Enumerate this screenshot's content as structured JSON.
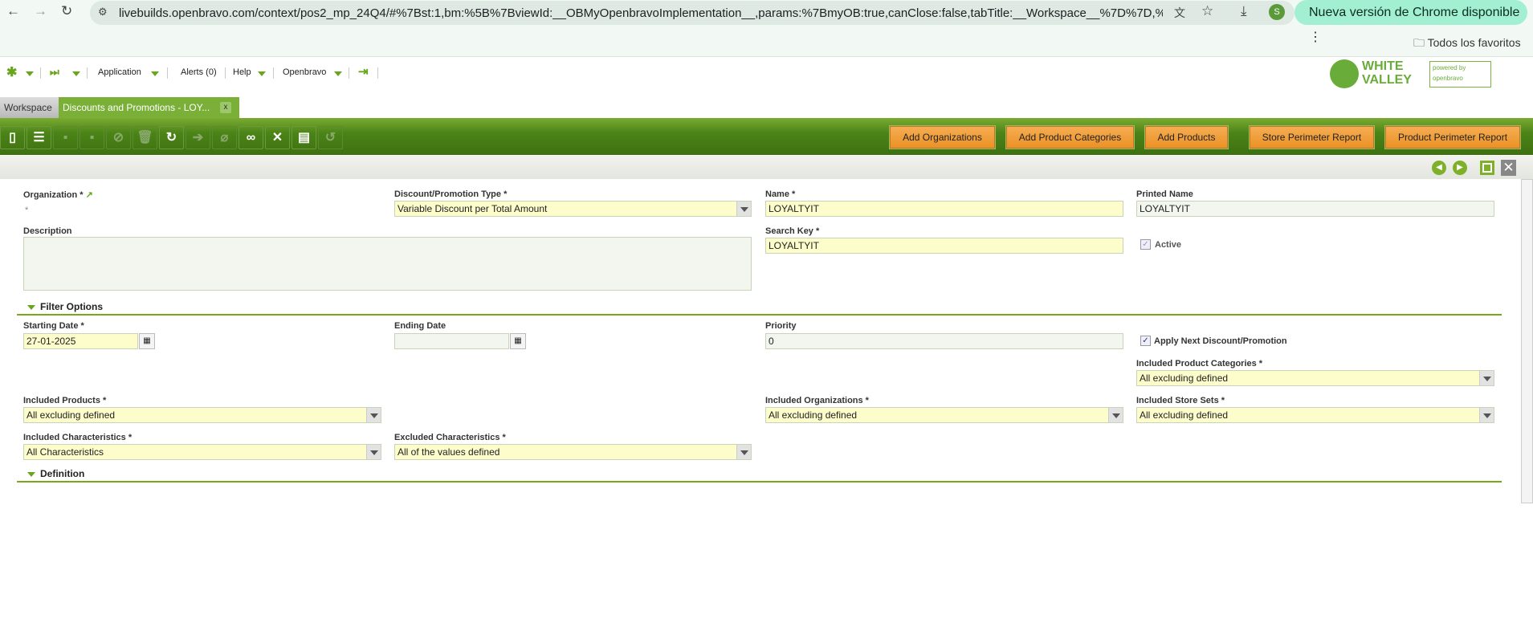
{
  "browser": {
    "url": "livebuilds.openbravo.com/context/pos2_mp_24Q4/#%7Bst:1,bm:%5B%7BviewId:__OBMyOpenbravoImplementation__,params:%7BmyOB:true,canClose:false,tabTitle:__Workspace__%7D%7D,%7BviewId:...",
    "update": "Nueva versión de Chrome disponible",
    "avatar": "S",
    "favorites": "Todos los favoritos"
  },
  "nav": {
    "application": "Application",
    "alerts": "Alerts (0)",
    "help": "Help",
    "user": "Openbravo"
  },
  "logos": {
    "white_valley": "WHITE VALLEY",
    "openbravo": "powered by openbravo"
  },
  "tabs": [
    {
      "label": "Workspace"
    },
    {
      "label": "Discounts and Promotions - LOY...",
      "close": "x"
    }
  ],
  "toolbar": {
    "buttons": [
      "Add Organizations",
      "Add Product Categories",
      "Add Products",
      "Store Perimeter Report",
      "Product Perimeter Report"
    ]
  },
  "form": {
    "organization": {
      "label": "Organization *",
      "value": "*"
    },
    "type": {
      "label": "Discount/Promotion Type *",
      "value": "Variable Discount per Total Amount"
    },
    "name": {
      "label": "Name *",
      "value": "LOYALTYIT"
    },
    "printed_name": {
      "label": "Printed Name",
      "value": "LOYALTYIT"
    },
    "description": {
      "label": "Description",
      "value": ""
    },
    "search_key": {
      "label": "Search Key *",
      "value": "LOYALTYIT"
    },
    "active": {
      "label": "Active",
      "checked": true
    },
    "filter_section": "Filter Options",
    "starting_date": {
      "label": "Starting Date *",
      "value": "27-01-2025"
    },
    "ending_date": {
      "label": "Ending Date",
      "value": ""
    },
    "priority": {
      "label": "Priority",
      "value": "0"
    },
    "apply_next": {
      "label": "Apply Next Discount/Promotion",
      "checked": true
    },
    "incl_prod_cat": {
      "label": "Included Product Categories *",
      "value": "All excluding defined"
    },
    "incl_products": {
      "label": "Included Products *",
      "value": "All excluding defined"
    },
    "incl_orgs": {
      "label": "Included Organizations *",
      "value": "All excluding defined"
    },
    "incl_store_sets": {
      "label": "Included Store Sets *",
      "value": "All excluding defined"
    },
    "incl_chars": {
      "label": "Included Characteristics *",
      "value": "All Characteristics"
    },
    "excl_chars": {
      "label": "Excluded Characteristics *",
      "value": "All of the values defined"
    },
    "definition_section": "Definition"
  }
}
